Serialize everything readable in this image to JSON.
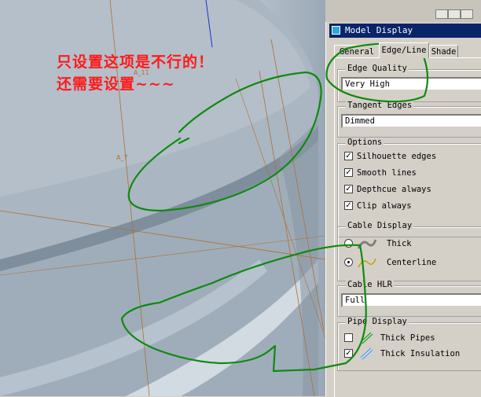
{
  "annotation": {
    "line1": "只设置这项是不行的！",
    "line2": "还需要设置~~~"
  },
  "viewport": {
    "datum_labels": [
      "A_11",
      "A_7"
    ]
  },
  "dialog": {
    "title": "Model Display",
    "tabs": [
      {
        "label": "General",
        "active": false
      },
      {
        "label": "Edge/Line",
        "active": true
      },
      {
        "label": "Shade",
        "active": false
      }
    ],
    "edge_quality": {
      "label": "Edge Quality",
      "value": "Very High"
    },
    "tangent_edges": {
      "label": "Tangent Edges",
      "value": "Dimmed"
    },
    "options": {
      "label": "Options",
      "items": [
        {
          "label": "Silhouette edges",
          "checked": true
        },
        {
          "label": "Smooth lines",
          "checked": true
        },
        {
          "label": "Depthcue always",
          "checked": true
        },
        {
          "label": "Clip always",
          "checked": true
        }
      ]
    },
    "cable_display": {
      "label": "Cable Display",
      "items": [
        {
          "label": "Thick",
          "selected": false,
          "icon": "thick-cable-icon"
        },
        {
          "label": "Centerline",
          "selected": true,
          "icon": "centerline-cable-icon"
        }
      ]
    },
    "cable_hlr": {
      "label": "Cable HLR",
      "value": "Full"
    },
    "pipe_display": {
      "label": "Pipe Display",
      "items": [
        {
          "label": "Thick Pipes",
          "checked": false,
          "icon": "thick-pipe-icon"
        },
        {
          "label": "Thick Insulation",
          "checked": true,
          "icon": "thick-insulation-icon"
        }
      ]
    }
  },
  "colors": {
    "annotation_text": "#ff1a1a",
    "highlight_stroke": "#0f8a0f",
    "title_bar": "#0a246a",
    "dialog_bg": "#d4d0c8"
  }
}
